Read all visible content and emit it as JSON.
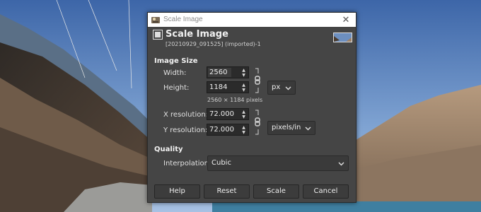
{
  "window": {
    "title": "Scale Image",
    "close_glyph": "✕"
  },
  "header": {
    "title": "Scale Image",
    "subtitle": "[20210929_091525] (imported)-1"
  },
  "image_size": {
    "section_title": "Image Size",
    "width_label": "Width:",
    "width_value": "2560",
    "height_label": "Height:",
    "height_value": "1184",
    "unit": "px",
    "pixels_note": "2560 × 1184 pixels"
  },
  "resolution": {
    "x_label": "X resolution:",
    "x_value": "72.000",
    "y_label": "Y resolution:",
    "y_value": "72.000",
    "unit": "pixels/in"
  },
  "quality": {
    "section_title": "Quality",
    "interpolation_label": "Interpolation:",
    "interpolation_value": "Cubic"
  },
  "buttons": {
    "help": "Help",
    "reset": "Reset",
    "scale": "Scale",
    "cancel": "Cancel"
  },
  "icons": [
    "gimp-app-icon",
    "scale-image-icon",
    "image-thumbnail",
    "chain-link-icon",
    "chevron-down-icon",
    "spin-up-icon",
    "spin-down-icon",
    "close-icon"
  ]
}
